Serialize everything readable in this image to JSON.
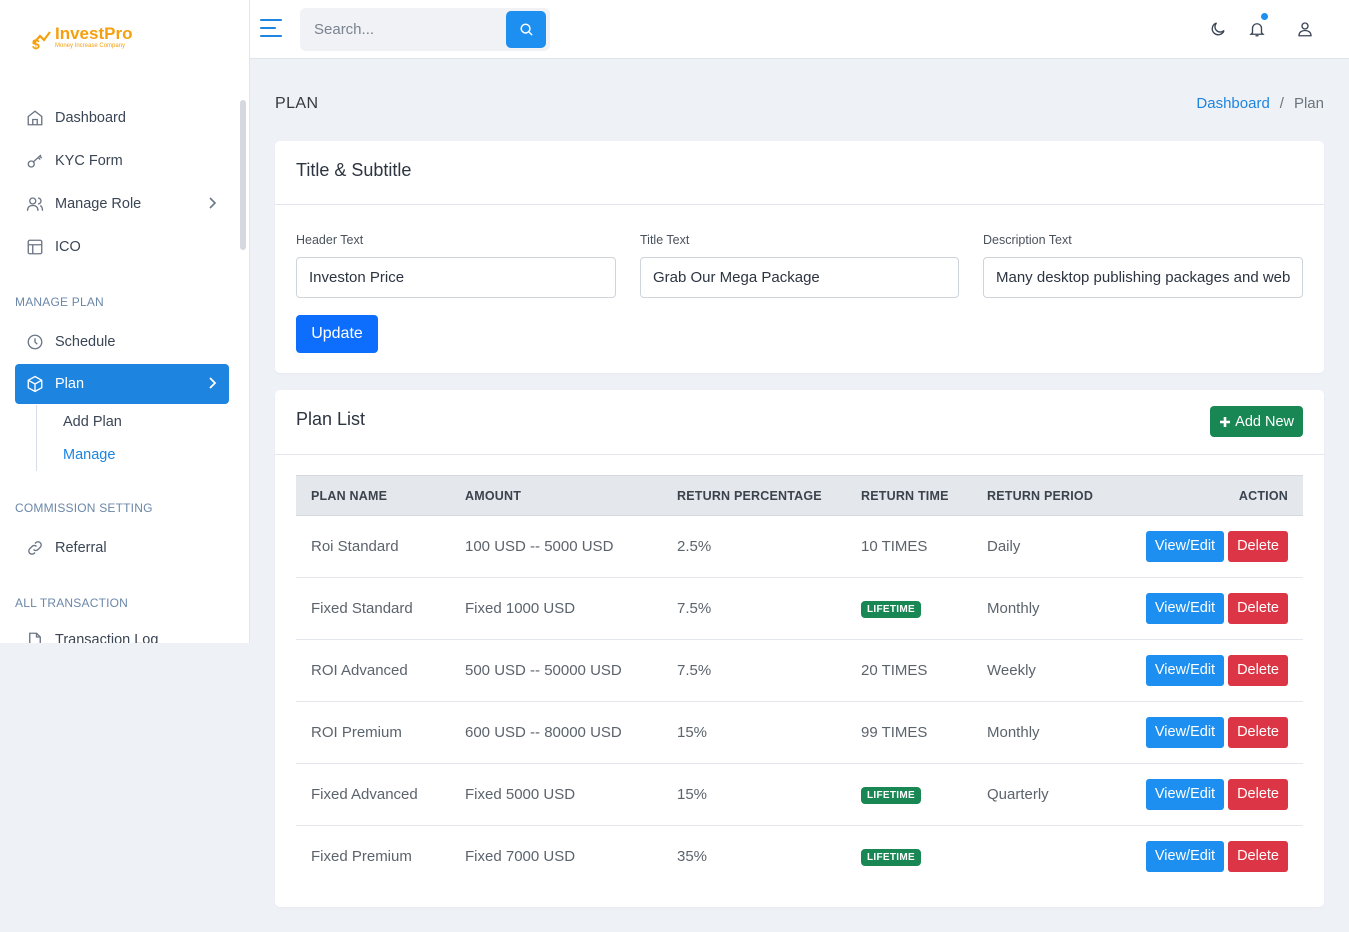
{
  "brand": {
    "name": "InvestPro",
    "tagline": "Money Increase Company"
  },
  "sidebar": {
    "items": [
      {
        "label": "Dashboard",
        "icon": "home-icon"
      },
      {
        "label": "KYC Form",
        "icon": "key-icon"
      },
      {
        "label": "Manage Role",
        "icon": "users-icon"
      },
      {
        "label": "ICO",
        "icon": "layout-icon"
      }
    ],
    "sections": [
      "MANAGE PLAN",
      "COMMISSION SETTING",
      "ALL TRANSACTION"
    ],
    "schedule": "Schedule",
    "plan": "Plan",
    "plan_sub": [
      "Add Plan",
      "Manage"
    ],
    "referral": "Referral",
    "transaction_log": "Transaction Log"
  },
  "topbar": {
    "search_placeholder": "Search..."
  },
  "page": {
    "title": "PLAN",
    "breadcrumb": [
      "Dashboard",
      "/",
      "Plan"
    ]
  },
  "title_card": {
    "title": "Title & Subtitle",
    "header_label": "Header Text",
    "header_value": "Investon Price",
    "title_label": "Title Text",
    "title_value": "Grab Our Mega Package",
    "desc_label": "Description Text",
    "desc_value": "Many desktop publishing packages and web page editors",
    "update_label": "Update"
  },
  "plan_list": {
    "title": "Plan List",
    "add_label": "Add New",
    "columns": [
      "PLAN NAME",
      "AMOUNT",
      "RETURN PERCENTAGE",
      "RETURN TIME",
      "RETURN PERIOD",
      "ACTION"
    ],
    "view_label": "View/Edit",
    "delete_label": "Delete",
    "rows": [
      {
        "name": "Roi Standard",
        "amount": "100 USD -- 5000 USD",
        "percent": "2.5%",
        "time": "10 TIMES",
        "time_badge": false,
        "period": "Daily"
      },
      {
        "name": "Fixed Standard",
        "amount": "Fixed 1000 USD",
        "percent": "7.5%",
        "time": "LIFETIME",
        "time_badge": true,
        "period": "Monthly"
      },
      {
        "name": "ROI Advanced",
        "amount": "500 USD -- 50000 USD",
        "percent": "7.5%",
        "time": "20 TIMES",
        "time_badge": false,
        "period": "Weekly"
      },
      {
        "name": "ROI Premium",
        "amount": "600 USD -- 80000 USD",
        "percent": "15%",
        "time": "99 TIMES",
        "time_badge": false,
        "period": "Monthly"
      },
      {
        "name": "Fixed Advanced",
        "amount": "Fixed 5000 USD",
        "percent": "15%",
        "time": "LIFETIME",
        "time_badge": true,
        "period": "Quarterly"
      },
      {
        "name": "Fixed Premium",
        "amount": "Fixed 7000 USD",
        "percent": "35%",
        "time": "LIFETIME",
        "time_badge": true,
        "period": ""
      }
    ]
  },
  "colors": {
    "primary": "#1d84e0",
    "success": "#198754",
    "danger": "#dc3545",
    "accent": "#f5a00f"
  }
}
